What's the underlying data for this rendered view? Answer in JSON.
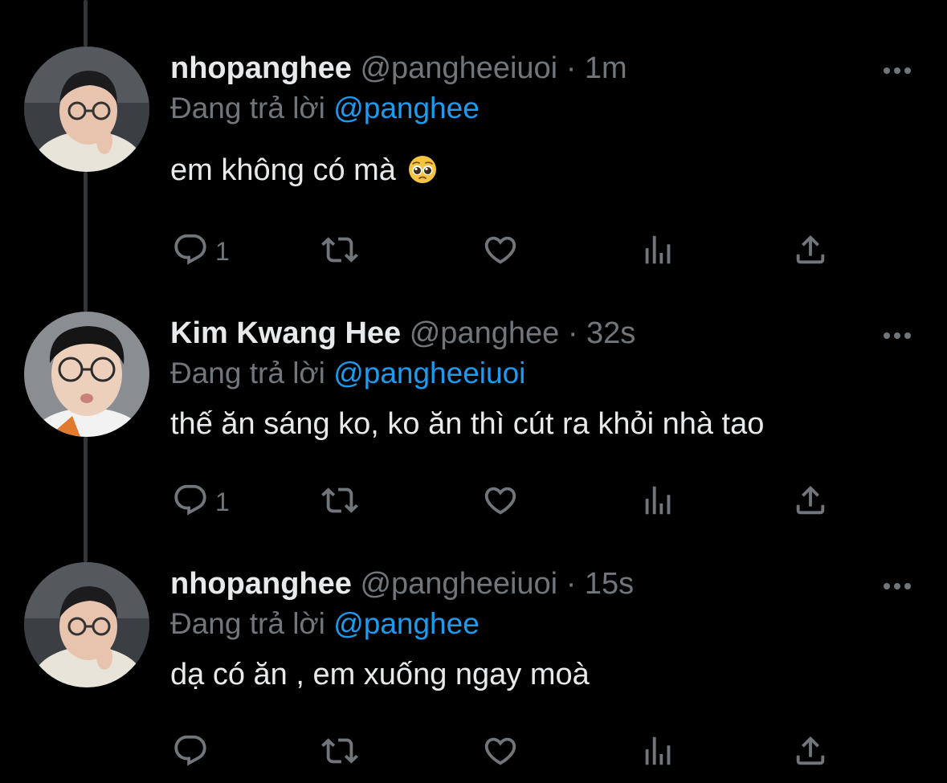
{
  "thread": {
    "tweets": [
      {
        "display_name": "nhopanghee",
        "handle": "@pangheeiuoi",
        "separator": "·",
        "time": "1m",
        "reply_prefix": "Đang trả lời",
        "reply_to": "@panghee",
        "text": "em không có mà",
        "emoji": "pleading-face",
        "reply_count": "1",
        "avatar": "nhopanghee-avatar"
      },
      {
        "display_name": "Kim Kwang Hee",
        "handle": "@panghee",
        "separator": "·",
        "time": "32s",
        "reply_prefix": "Đang trả lời",
        "reply_to": "@pangheeiuoi",
        "text": "thế ăn sáng ko, ko ăn thì cút ra khỏi nhà tao",
        "reply_count": "1",
        "avatar": "kimkwanghee-avatar"
      },
      {
        "display_name": "nhopanghee",
        "handle": "@pangheeiuoi",
        "separator": "·",
        "time": "15s",
        "reply_prefix": "Đang trả lời",
        "reply_to": "@panghee",
        "text": "dạ có ăn , em xuống ngay moà",
        "reply_count": "",
        "avatar": "nhopanghee-avatar"
      }
    ]
  },
  "icons": {
    "reply": "reply-icon",
    "retweet": "retweet-icon",
    "like": "heart-icon",
    "views": "views-icon",
    "share": "share-icon",
    "more": "more-icon"
  },
  "colors": {
    "background": "#000000",
    "primary_text": "#E7E9EA",
    "secondary_text": "#71767B",
    "mention": "#1D9BF0",
    "thread_line": "#333639"
  }
}
